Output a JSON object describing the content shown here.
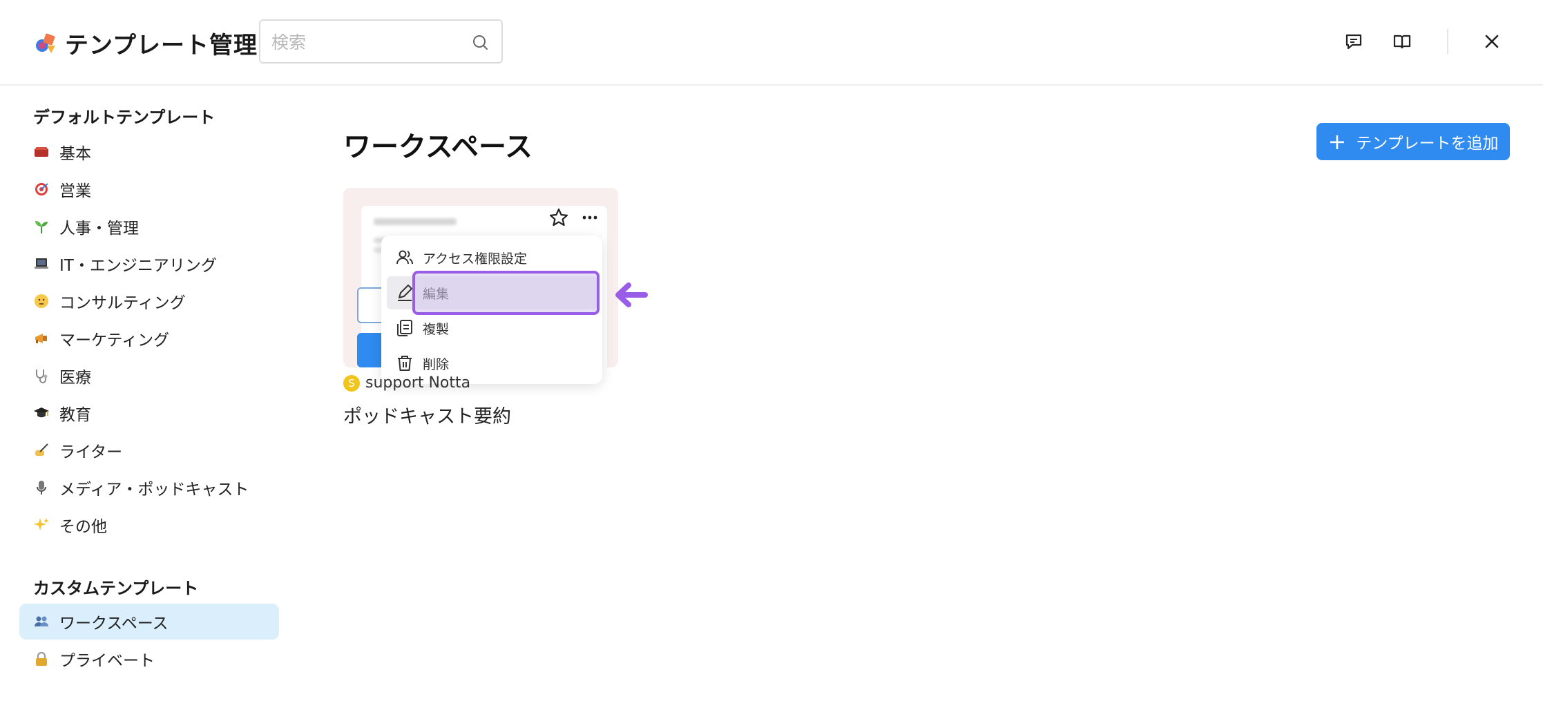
{
  "header": {
    "title": "テンプレート管理",
    "search_placeholder": "検索"
  },
  "sidebar": {
    "default_section": "デフォルトテンプレート",
    "default_items": [
      {
        "label": "基本",
        "icon": "brick-icon"
      },
      {
        "label": "営業",
        "icon": "target-icon"
      },
      {
        "label": "人事・管理",
        "icon": "seedling-icon"
      },
      {
        "label": "IT・エンジニアリング",
        "icon": "laptop-icon"
      },
      {
        "label": "コンサルティング",
        "icon": "thinking-face-icon"
      },
      {
        "label": "マーケティング",
        "icon": "megaphone-icon"
      },
      {
        "label": "医療",
        "icon": "stethoscope-icon"
      },
      {
        "label": "教育",
        "icon": "graduation-cap-icon"
      },
      {
        "label": "ライター",
        "icon": "writing-hand-icon"
      },
      {
        "label": "メディア・ポッドキャスト",
        "icon": "microphone-icon"
      },
      {
        "label": "その他",
        "icon": "sparkles-icon"
      }
    ],
    "custom_section": "カスタムテンプレート",
    "custom_items": [
      {
        "label": "ワークスペース",
        "icon": "people-icon",
        "active": true
      },
      {
        "label": "プライベート",
        "icon": "lock-icon",
        "active": false
      }
    ]
  },
  "main": {
    "title": "ワークスペース",
    "add_button": "テンプレートを追加",
    "card": {
      "author_initial": "S",
      "author": "support Notta",
      "title": "ポッドキャスト要約"
    },
    "menu": [
      {
        "label": "アクセス権限設定",
        "icon": "users-icon"
      },
      {
        "label": "編集",
        "icon": "pencil-icon"
      },
      {
        "label": "複製",
        "icon": "copy-icon"
      },
      {
        "label": "削除",
        "icon": "trash-icon"
      }
    ]
  },
  "colors": {
    "accent": "#2f8bf0",
    "active_bg": "#dbeefc",
    "highlight": "#9a5de8",
    "card_bg": "#f8eeee"
  }
}
